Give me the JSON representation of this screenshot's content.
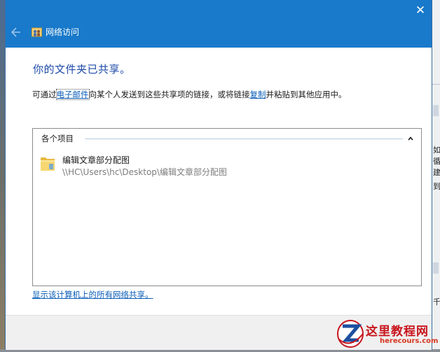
{
  "window": {
    "title": "网络访问",
    "close_glyph": "✕"
  },
  "main": {
    "heading": "你的文件夹已共享。",
    "desc": {
      "prefix": "可通过",
      "email_link": "电子邮件",
      "middle": "向某个人发送到这些共享项的链接，或将链接",
      "copy_link": "复制",
      "suffix": "并粘贴到其他应用中。"
    },
    "panel": {
      "group_header": "各个项目",
      "items": [
        {
          "name": "编辑文章部分配图",
          "path": "\\\\HC\\Users\\hc\\Desktop\\编辑文章部分配图",
          "icon": "folder-icon"
        }
      ]
    },
    "bottom_link": "显示该计算机上的所有网络共享。"
  },
  "background": {
    "right_fragments": [
      "如",
      "循",
      "建",
      "到",
      "千"
    ]
  },
  "watermark": {
    "title": "这里教程网",
    "url": "herecours.com"
  },
  "colors": {
    "titlebar": "#1979ca",
    "heading": "#1d4aa8",
    "link": "#0a5db8",
    "watermark": "#c8161d"
  }
}
